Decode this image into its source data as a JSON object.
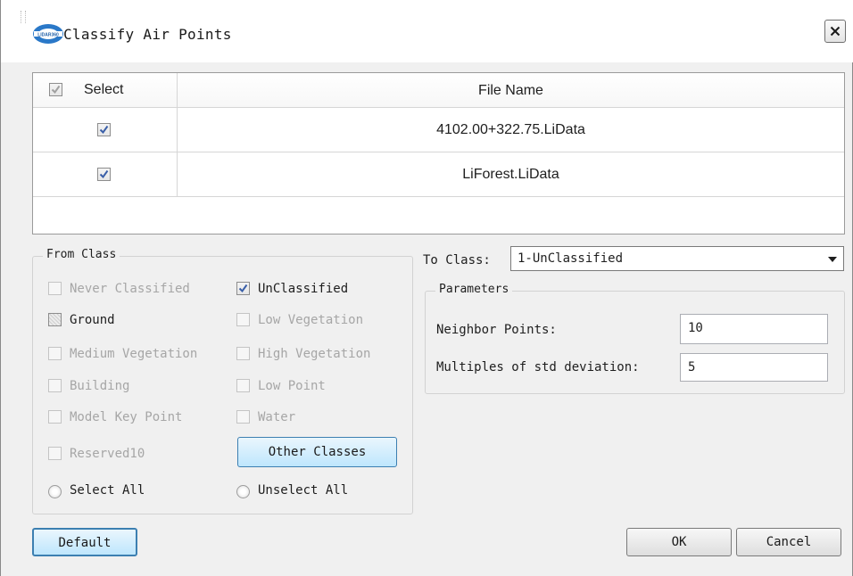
{
  "window": {
    "title": "Classify Air Points",
    "logo_icon": "lidar-logo-icon",
    "close_icon": "close-icon"
  },
  "table": {
    "headers": {
      "select": "Select",
      "file_name": "File Name"
    },
    "header_checked": true,
    "rows": [
      {
        "checked": true,
        "file_name": "4102.00+322.75.LiData"
      },
      {
        "checked": true,
        "file_name": "LiForest.LiData"
      }
    ]
  },
  "from_class": {
    "legend": "From Class",
    "options": [
      {
        "label": "Never Classified",
        "checked": false,
        "enabled": false
      },
      {
        "label": "UnClassified",
        "checked": true,
        "enabled": true
      },
      {
        "label": "Ground",
        "checked": false,
        "enabled": true
      },
      {
        "label": "Low Vegetation",
        "checked": false,
        "enabled": false
      },
      {
        "label": "Medium Vegetation",
        "checked": false,
        "enabled": false
      },
      {
        "label": "High Vegetation",
        "checked": false,
        "enabled": false
      },
      {
        "label": "Building",
        "checked": false,
        "enabled": false
      },
      {
        "label": "Low Point",
        "checked": false,
        "enabled": false
      },
      {
        "label": "Model Key Point",
        "checked": false,
        "enabled": false
      },
      {
        "label": "Water",
        "checked": false,
        "enabled": false
      },
      {
        "label": "Reserved10",
        "checked": false,
        "enabled": false
      }
    ],
    "other_classes_button": "Other Classes",
    "select_all": "Select All",
    "unselect_all": "Unselect All"
  },
  "to_class": {
    "label": "To Class:",
    "value": "1-UnClassified"
  },
  "parameters": {
    "legend": "Parameters",
    "neighbor_points_label": "Neighbor Points:",
    "neighbor_points_value": "10",
    "std_dev_label": "Multiples of std deviation:",
    "std_dev_value": "5"
  },
  "buttons": {
    "default": "Default",
    "ok": "OK",
    "cancel": "Cancel"
  },
  "colors": {
    "accent_button": "#bee6fd",
    "check": "#3a5fa8",
    "disabled_text": "#a6a6a6"
  }
}
